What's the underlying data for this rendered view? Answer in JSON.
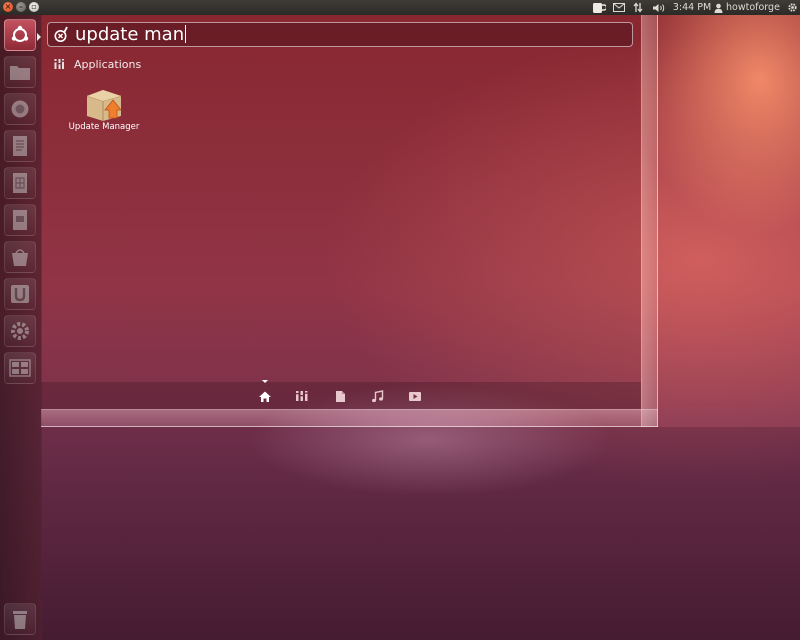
{
  "window_controls": {
    "close_icon": "close-icon",
    "minimize_icon": "minimize-icon",
    "maximize_icon": "maximize-icon"
  },
  "top_panel": {
    "indicators": [
      "mug-icon",
      "mail-icon",
      "network-icon",
      "volume-icon"
    ],
    "clock": "3:44 PM",
    "user_name": "howtoforge",
    "session_icon": "gear-icon"
  },
  "launcher": {
    "items": [
      {
        "name": "dash-home-button",
        "icon": "ubuntu-logo-icon"
      },
      {
        "name": "files-launcher",
        "icon": "folder-icon"
      },
      {
        "name": "firefox-launcher",
        "icon": "firefox-icon"
      },
      {
        "name": "writer-launcher",
        "icon": "document-icon"
      },
      {
        "name": "calc-launcher",
        "icon": "spreadsheet-icon"
      },
      {
        "name": "impress-launcher",
        "icon": "presentation-icon"
      },
      {
        "name": "software-center-launcher",
        "icon": "software-center-icon"
      },
      {
        "name": "ubuntu-one-launcher",
        "icon": "ubuntu-one-icon"
      },
      {
        "name": "system-settings-launcher",
        "icon": "settings-icon"
      },
      {
        "name": "workspace-switcher-launcher",
        "icon": "workspace-icon"
      },
      {
        "name": "trash-launcher",
        "icon": "trash-icon"
      }
    ]
  },
  "dash": {
    "search": {
      "value": "update man",
      "icon": "search-icon"
    },
    "category": {
      "label": "Applications",
      "icon": "applications-lens-icon"
    },
    "results": [
      {
        "label": "Update Manager",
        "icon": "update-manager-icon"
      }
    ],
    "lens_bar": [
      {
        "name": "home-lens",
        "icon": "home-icon",
        "active": true
      },
      {
        "name": "applications-lens",
        "icon": "applications-icon",
        "active": false
      },
      {
        "name": "files-lens",
        "icon": "file-icon",
        "active": false
      },
      {
        "name": "music-lens",
        "icon": "music-icon",
        "active": false
      },
      {
        "name": "video-lens",
        "icon": "video-icon",
        "active": false
      }
    ]
  }
}
